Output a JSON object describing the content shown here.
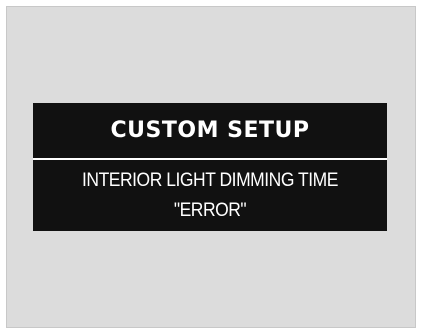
{
  "screen": {
    "title": "CUSTOM SETUP",
    "setting_name": "INTERIOR LIGHT DIMMING TIME",
    "status": "\"ERROR\""
  },
  "colors": {
    "background": "#dcdcdc",
    "display": "#111111",
    "text": "#ffffff"
  }
}
